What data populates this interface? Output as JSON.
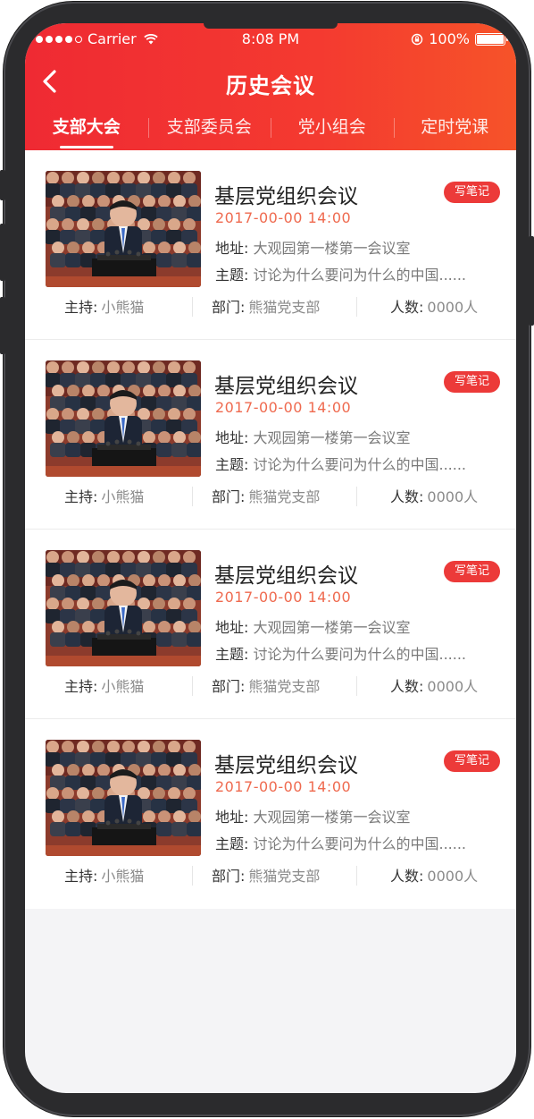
{
  "status_bar": {
    "carrier": "Carrier",
    "time": "8:08 PM",
    "battery": "100%"
  },
  "header": {
    "title": "历史会议",
    "back_icon": "chevron-left-icon"
  },
  "tabs": [
    {
      "label": "支部大会",
      "active": true
    },
    {
      "label": "支部委员会",
      "active": false
    },
    {
      "label": "党小组会",
      "active": false
    },
    {
      "label": "定时党课",
      "active": false
    }
  ],
  "meetings": [
    {
      "title": "基层党组织会议",
      "note_label": "写笔记",
      "datetime": "2017-00-00  14:00",
      "address_label": "地址:",
      "address": "大观园第一楼第一会议室",
      "topic_label": "主题:",
      "topic": "讨论为什么要问为什么的中国......",
      "host_label": "主持:",
      "host": "小熊猫",
      "dept_label": "部门:",
      "dept": "熊猫党支部",
      "count_label": "人数:",
      "count": "0000人"
    },
    {
      "title": "基层党组织会议",
      "note_label": "写笔记",
      "datetime": "2017-00-00  14:00",
      "address_label": "地址:",
      "address": "大观园第一楼第一会议室",
      "topic_label": "主题:",
      "topic": "讨论为什么要问为什么的中国......",
      "host_label": "主持:",
      "host": "小熊猫",
      "dept_label": "部门:",
      "dept": "熊猫党支部",
      "count_label": "人数:",
      "count": "0000人"
    },
    {
      "title": "基层党组织会议",
      "note_label": "写笔记",
      "datetime": "2017-00-00  14:00",
      "address_label": "地址:",
      "address": "大观园第一楼第一会议室",
      "topic_label": "主题:",
      "topic": "讨论为什么要问为什么的中国......",
      "host_label": "主持:",
      "host": "小熊猫",
      "dept_label": "部门:",
      "dept": "熊猫党支部",
      "count_label": "人数:",
      "count": "0000人"
    },
    {
      "title": "基层党组织会议",
      "note_label": "写笔记",
      "datetime": "2017-00-00  14:00",
      "address_label": "地址:",
      "address": "大观园第一楼第一会议室",
      "topic_label": "主题:",
      "topic": "讨论为什么要问为什么的中国......",
      "host_label": "主持:",
      "host": "小熊猫",
      "dept_label": "部门:",
      "dept": "熊猫党支部",
      "count_label": "人数:",
      "count": "0000人"
    }
  ],
  "colors": {
    "header_red": "#ef2a33",
    "header_orange": "#f65329",
    "accent": "#ec3a39",
    "datetime": "#ef6a4f"
  }
}
